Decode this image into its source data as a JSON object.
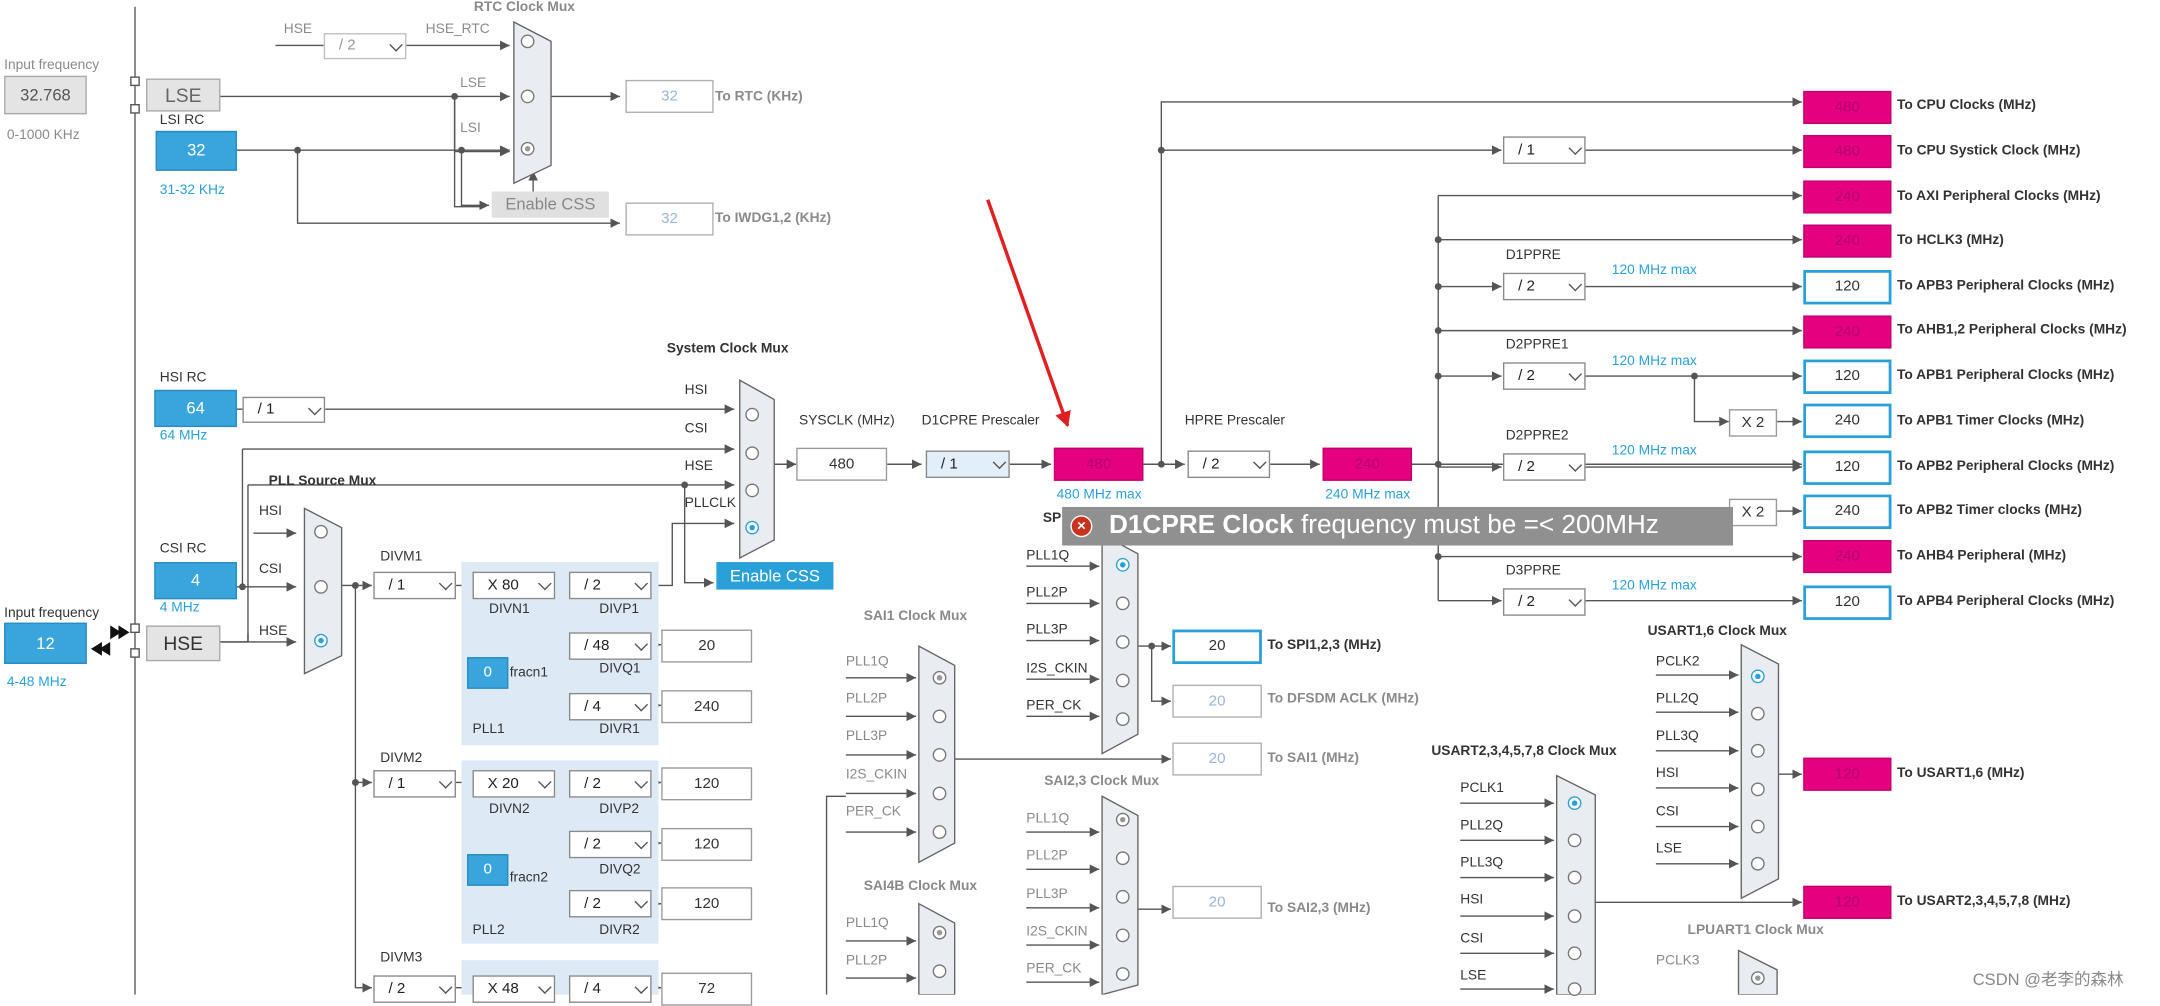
{
  "input_lse": {
    "caption": "Input frequency",
    "value": "32.768",
    "range": "0-1000 KHz"
  },
  "input_hse": {
    "caption": "Input frequency",
    "value": "12",
    "range": "4-48 MHz"
  },
  "sources": {
    "lse": "LSE",
    "hse": "HSE",
    "lsi_rc": {
      "title": "LSI RC",
      "value": "32",
      "range": "31-32 KHz"
    },
    "hsi_rc": {
      "title": "HSI RC",
      "value": "64",
      "range": "64 MHz",
      "div": "/ 1"
    },
    "csi_rc": {
      "title": "CSI RC",
      "value": "4",
      "range": "4 MHz"
    }
  },
  "rtc": {
    "mux_title": "RTC Clock Mux",
    "hse_label": "HSE",
    "hse_div": "/ 2",
    "hse_rtc_label": "HSE_RTC",
    "lse_label": "LSE",
    "lsi_label": "LSI",
    "enable_css": "Enable CSS",
    "rtc_value": "32",
    "rtc_out": "To RTC (KHz)",
    "iwdg_value": "32",
    "iwdg_out": "To IWDG1,2 (KHz)"
  },
  "pll_source_mux": {
    "title": "PLL Source Mux",
    "hsi": "HSI",
    "csi": "CSI",
    "hse": "HSE"
  },
  "sys_mux": {
    "title": "System Clock Mux",
    "hsi": "HSI",
    "csi": "CSI",
    "hse": "HSE",
    "pllclk": "PLLCLK",
    "enable_css": "Enable CSS"
  },
  "pll1": {
    "divm_label": "DIVM1",
    "divm": "/ 1",
    "divn": "X 80",
    "divn_label": "DIVN1",
    "divp": "/ 2",
    "divp_label": "DIVP1",
    "divq": "/ 48",
    "divq_label": "DIVQ1",
    "q_value": "20",
    "divr": "/ 4",
    "divr_label": "DIVR1",
    "r_value": "240",
    "fracn": "0",
    "fracn_label": "fracn1",
    "name": "PLL1"
  },
  "pll2": {
    "divm_label": "DIVM2",
    "divm": "/ 1",
    "divn": "X 20",
    "divn_label": "DIVN2",
    "divp": "/ 2",
    "divp_label": "DIVP2",
    "p_value": "120",
    "divq": "/ 2",
    "divq_label": "DIVQ2",
    "q_value": "120",
    "divr": "/ 2",
    "divr_label": "DIVR2",
    "r_value": "120",
    "fracn": "0",
    "fracn_label": "fracn2",
    "name": "PLL2"
  },
  "pll3": {
    "divm_label": "DIVM3",
    "divm": "/ 2",
    "divn": "X 48",
    "divp": "/ 4",
    "p_value": "72"
  },
  "sysclk": {
    "label": "SYSCLK (MHz)",
    "value": "480"
  },
  "d1cpre": {
    "label": "D1CPRE Prescaler",
    "value": "/ 1",
    "out": "480",
    "max": "480 MHz max"
  },
  "hpre": {
    "label": "HPRE Prescaler",
    "value": "/ 2",
    "out": "240",
    "max": "240 MHz max"
  },
  "outputs": {
    "cpu": {
      "value": "480",
      "label": "To CPU Clocks (MHz)"
    },
    "systick": {
      "div": "/ 1",
      "value": "480",
      "label": "To CPU Systick Clock (MHz)"
    },
    "axi": {
      "value": "240",
      "label": "To AXI Peripheral Clocks (MHz)"
    },
    "hclk3": {
      "value": "240",
      "label": "To HCLK3 (MHz)"
    },
    "apb3": {
      "presc_label": "D1PPRE",
      "div": "/ 2",
      "max": "120 MHz max",
      "value": "120",
      "label": "To APB3 Peripheral Clocks (MHz)"
    },
    "ahb12": {
      "value": "240",
      "label": "To AHB1,2 Peripheral Clocks (MHz)"
    },
    "apb1": {
      "presc_label": "D2PPRE1",
      "div": "/ 2",
      "max": "120 MHz max",
      "value": "120",
      "label": "To APB1 Peripheral Clocks (MHz)"
    },
    "apb1_timer": {
      "mult": "X 2",
      "value": "240",
      "label": "To APB1 Timer Clocks (MHz)"
    },
    "apb2": {
      "presc_label": "D2PPRE2",
      "div": "/ 2",
      "max": "120 MHz max",
      "value": "120",
      "label": "To APB2 Peripheral Clocks (MHz)"
    },
    "apb2_timer": {
      "mult": "X 2",
      "value": "240",
      "label": "To APB2 Timer clocks (MHz)"
    },
    "ahb4": {
      "value": "240",
      "label": "To AHB4 Peripheral (MHz)"
    },
    "apb4": {
      "presc_label": "D3PPRE",
      "div": "/ 2",
      "max": "120 MHz max",
      "value": "120",
      "label": "To APB4 Peripheral Clocks (MHz)"
    }
  },
  "spi_mux": {
    "title": "SP",
    "inputs": [
      "PLL1Q",
      "PLL2P",
      "PLL3P",
      "I2S_CKIN",
      "PER_CK"
    ],
    "spi_value": "20",
    "spi_label": "To SPI1,2,3 (MHz)",
    "dfsdm_value": "20",
    "dfsdm_label": "To DFSDM ACLK (MHz)"
  },
  "sai1_mux": {
    "title": "SAI1 Clock Mux",
    "inputs": [
      "PLL1Q",
      "PLL2P",
      "PLL3P",
      "I2S_CKIN",
      "PER_CK"
    ],
    "value": "20",
    "label": "To SAI1 (MHz)"
  },
  "sai23_mux": {
    "title": "SAI2,3 Clock Mux",
    "inputs": [
      "PLL1Q",
      "PLL2P",
      "PLL3P",
      "I2S_CKIN",
      "PER_CK"
    ],
    "value": "20",
    "label": "To SAI2,3 (MHz)"
  },
  "sai4b_mux": {
    "title": "SAI4B Clock Mux",
    "inputs": [
      "PLL1Q",
      "PLL2P"
    ]
  },
  "usart16_mux": {
    "title": "USART1,6 Clock Mux",
    "inputs": [
      "PCLK2",
      "PLL2Q",
      "PLL3Q",
      "HSI",
      "CSI",
      "LSE"
    ],
    "value": "120",
    "label": "To USART1,6 (MHz)"
  },
  "usart2_mux": {
    "title": "USART2,3,4,5,7,8 Clock Mux",
    "inputs": [
      "PCLK1",
      "PLL2Q",
      "PLL3Q",
      "HSI",
      "CSI",
      "LSE"
    ],
    "value": "120",
    "label": "To USART2,3,4,5,7,8 (MHz)"
  },
  "lpuart_mux": {
    "title": "LPUART1 Clock Mux",
    "inputs": [
      "PCLK3"
    ]
  },
  "tooltip": {
    "icon": "×",
    "bold": "D1CPRE Clock",
    "rest": " frequency must be =< 200MHz"
  },
  "watermark": "CSDN @老李的森林",
  "colors": {
    "error_magenta": "#e4007f",
    "source_blue": "#3aa4dc",
    "arrow_red": "#e02020",
    "panel": "#dde9f5"
  }
}
